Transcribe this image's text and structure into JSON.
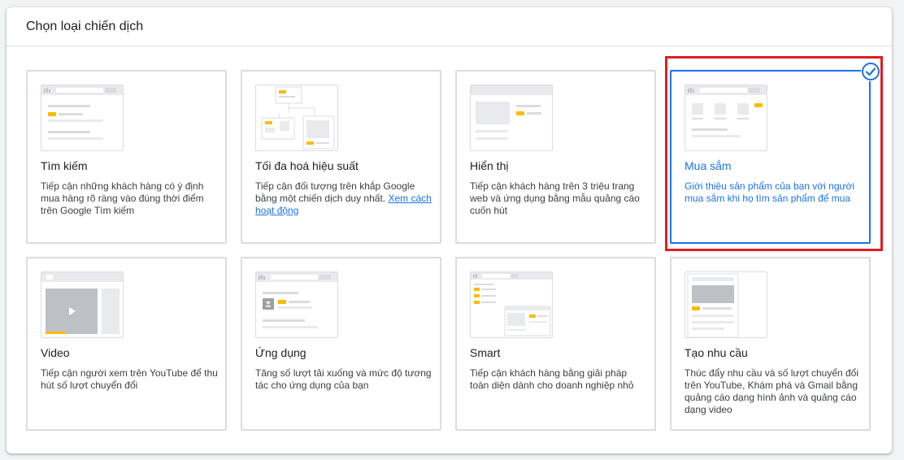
{
  "panel": {
    "title": "Chọn loại chiến dịch"
  },
  "colors": {
    "accent": "#1a73e8",
    "highlight": "#e11d22",
    "illustration_yellow": "#fbbc04"
  },
  "cards": [
    {
      "title": "Tìm kiếm",
      "description": "Tiếp cận những khách hàng có ý định mua hàng rõ ràng vào đúng thời điểm trên Google Tìm kiếm",
      "icon": "search-illustration-icon"
    },
    {
      "title": "Tối đa hoá hiệu suất",
      "description": "Tiếp cận đối tượng trên khắp Google bằng một chiến dịch duy nhất.",
      "link": "Xem cách hoạt động",
      "icon": "performance-max-illustration-icon"
    },
    {
      "title": "Hiển thị",
      "description": "Tiếp cận khách hàng trên 3 triệu trang web và ứng dụng bằng mẫu quảng cáo cuốn hút",
      "icon": "display-illustration-icon"
    },
    {
      "title": "Mua sắm",
      "description": "Giới thiệu sản phẩm của bạn với người mua sắm khi họ tìm sản phẩm để mua",
      "icon": "shopping-illustration-icon",
      "selected": true
    },
    {
      "title": "Video",
      "description": "Tiếp cận người xem trên YouTube để thu hút số lượt chuyển đổi",
      "icon": "video-illustration-icon"
    },
    {
      "title": "Ứng dụng",
      "description": "Tăng số lượt tải xuống và mức độ tương tác cho ứng dụng của bạn",
      "icon": "app-illustration-icon"
    },
    {
      "title": "Smart",
      "description": "Tiếp cận khách hàng bằng giải pháp toàn diện dành cho doanh nghiệp nhỏ",
      "icon": "smart-illustration-icon"
    },
    {
      "title": "Tạo nhu cầu",
      "description": "Thúc đẩy nhu cầu và số lượt chuyển đổi trên YouTube, Khám phá và Gmail bằng quảng cáo dạng hình ảnh và quảng cáo dạng video",
      "icon": "demand-gen-illustration-icon"
    }
  ]
}
